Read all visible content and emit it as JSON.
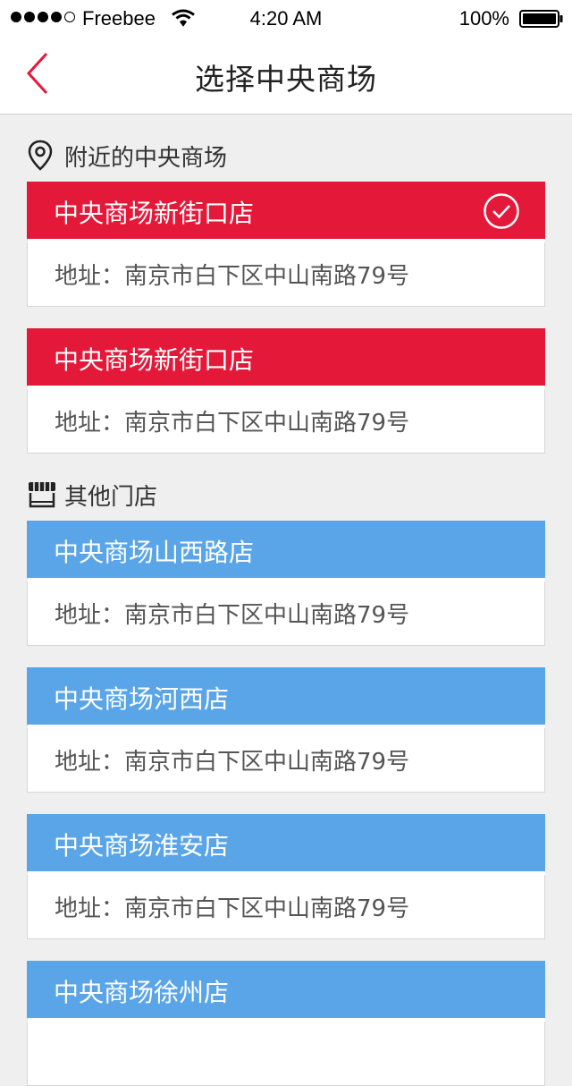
{
  "status_bar": {
    "carrier": "Freebee",
    "time": "4:20 AM",
    "battery": "100%",
    "signal_bars": 4,
    "signal_total": 5
  },
  "nav": {
    "title": "选择中央商场"
  },
  "nearby": {
    "title": "附近的中央商场",
    "stores": [
      {
        "name": "中央商场新街口店",
        "address": "地址：南京市白下区中山南路79号",
        "selected": true
      },
      {
        "name": "中央商场新街口店",
        "address": "地址：南京市白下区中山南路79号",
        "selected": false
      }
    ]
  },
  "others": {
    "title": "其他门店",
    "stores": [
      {
        "name": "中央商场山西路店",
        "address": "地址：南京市白下区中山南路79号"
      },
      {
        "name": "中央商场河西店",
        "address": "地址：南京市白下区中山南路79号"
      },
      {
        "name": "中央商场淮安店",
        "address": "地址：南京市白下区中山南路79号"
      },
      {
        "name": "中央商场徐州店"
      }
    ]
  },
  "colors": {
    "accent_red": "#e4193a",
    "accent_blue": "#5aa5e8",
    "background": "#efefef"
  }
}
